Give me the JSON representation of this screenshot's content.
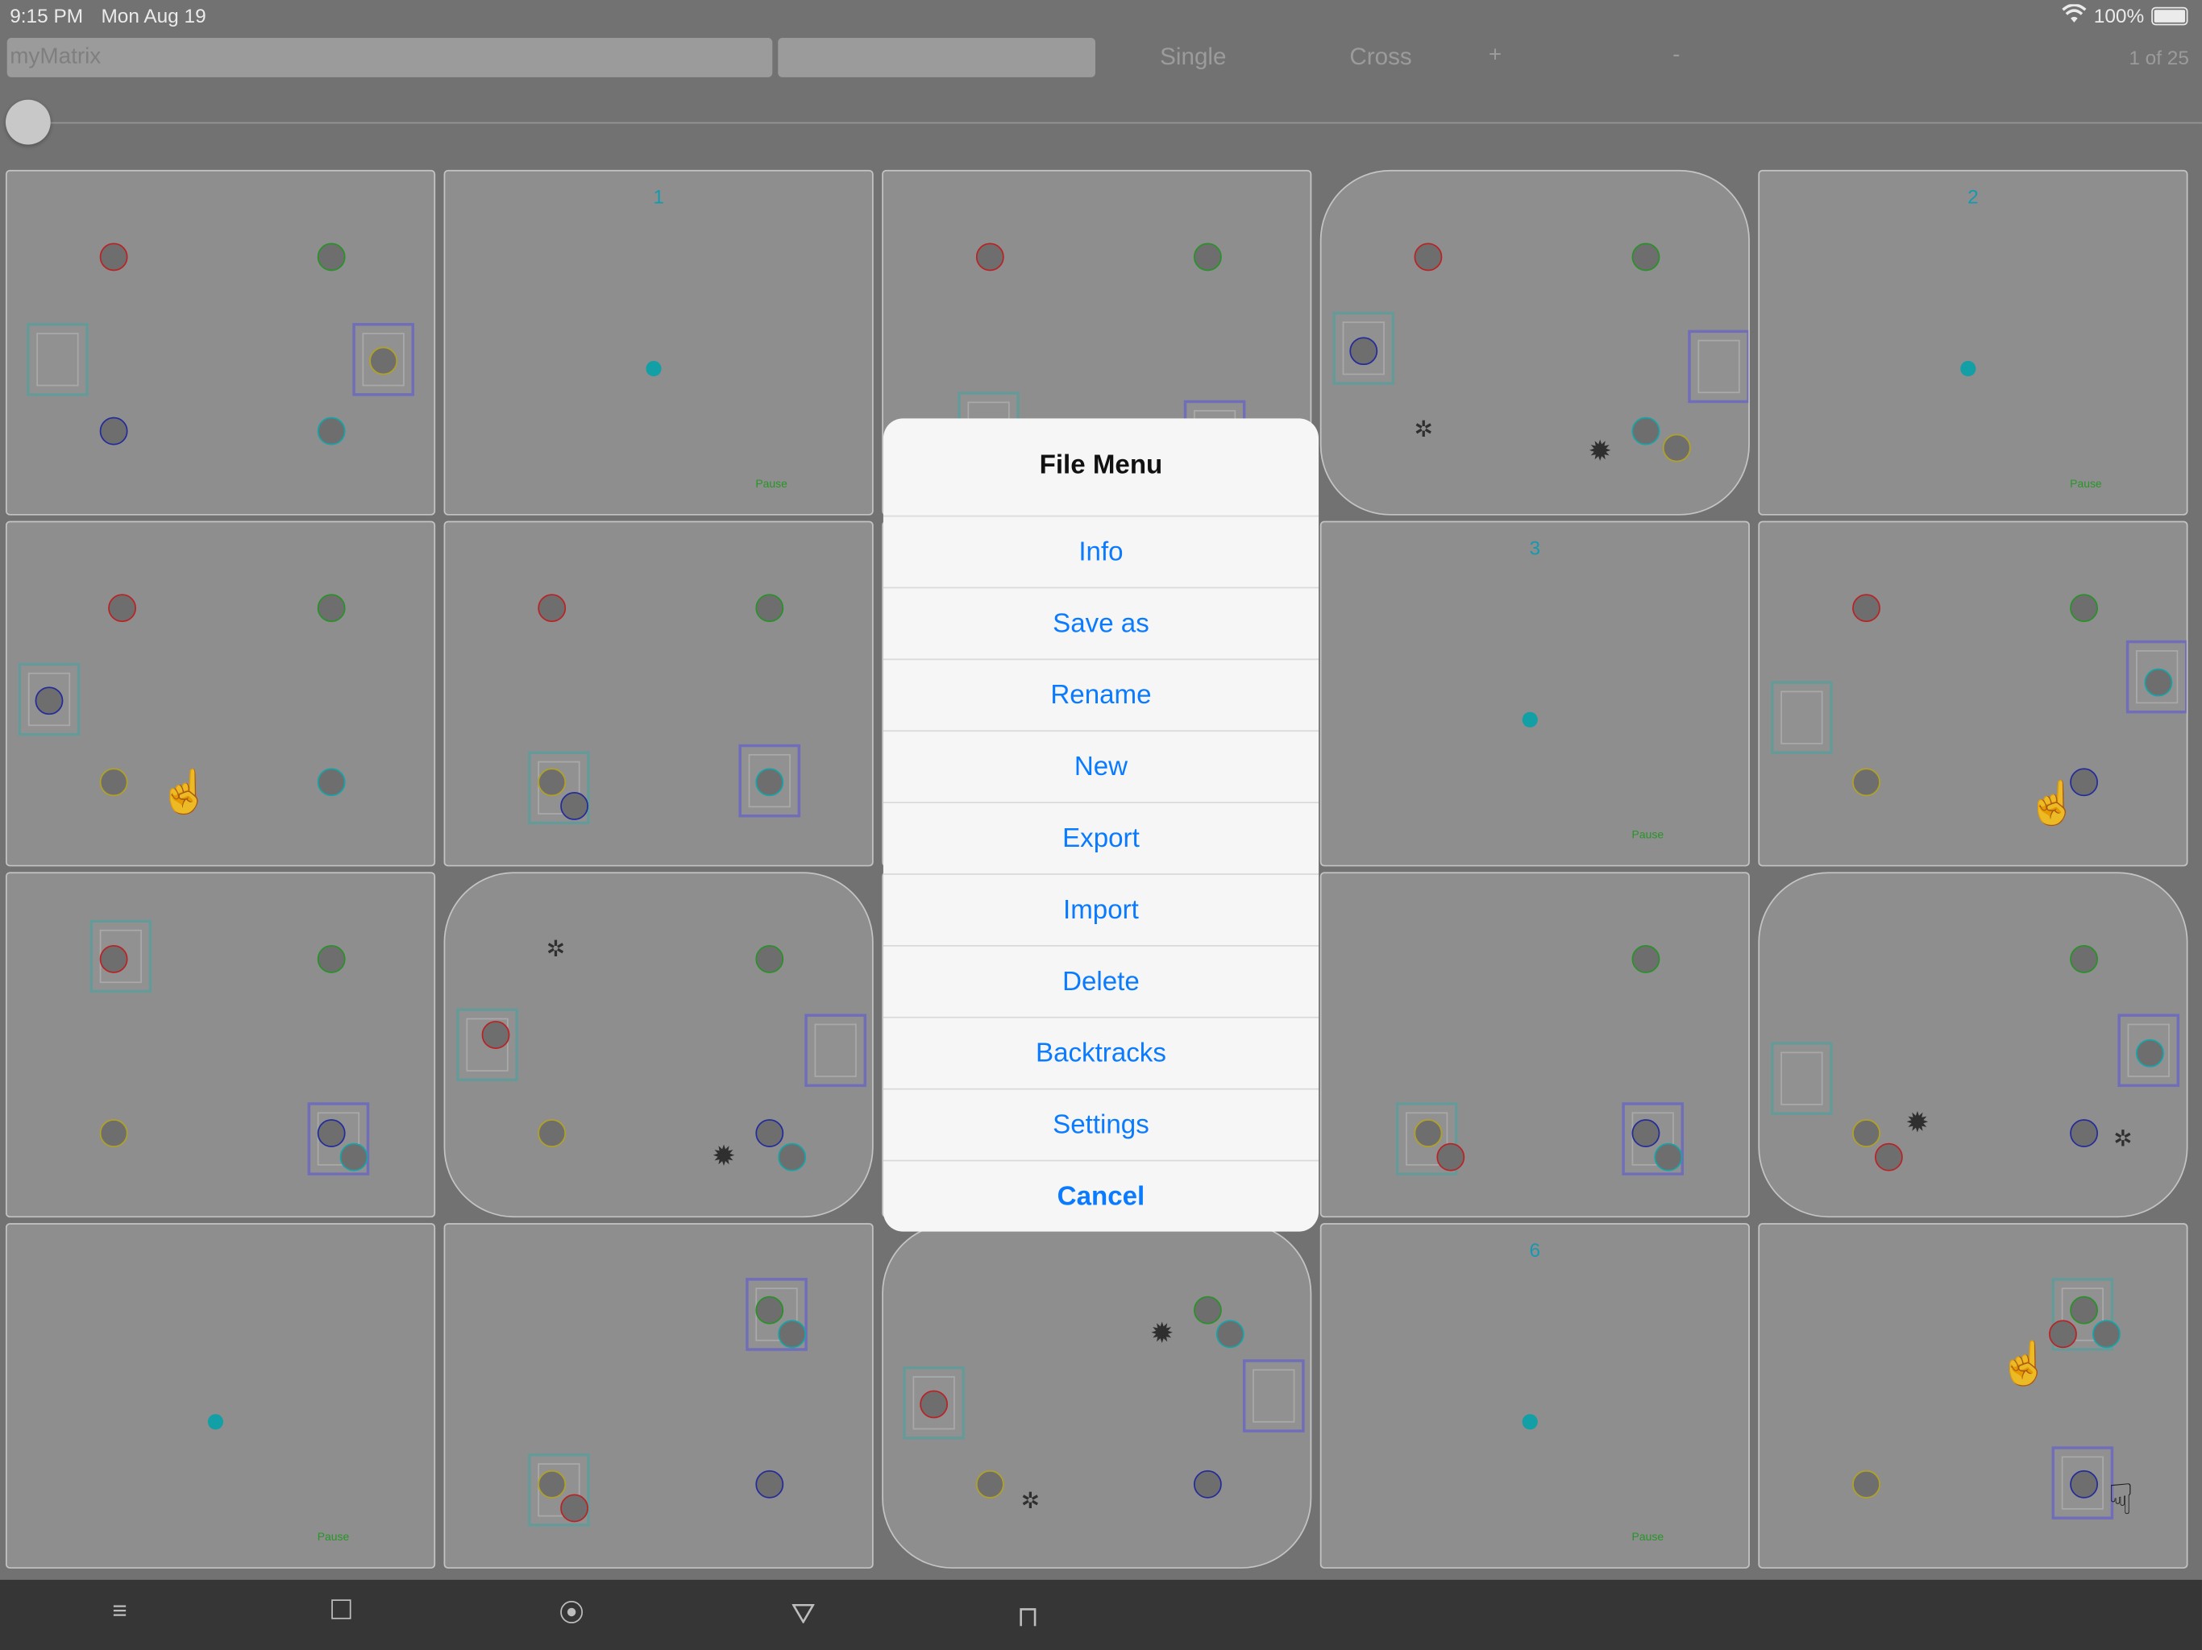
{
  "status": {
    "time": "9:15 PM",
    "date": "Mon Aug 19",
    "battery": "100%"
  },
  "toolbar": {
    "name_value": "myMatrix",
    "second_value": "",
    "single_label": "Single",
    "cross_label": "Cross",
    "plus_label": "+",
    "minus_label": "-",
    "page_counter": "1 of 25"
  },
  "cells": {
    "c2_number": "1",
    "c2_pause": "Pause",
    "c5_number": "2",
    "c5_pause": "Pause",
    "c8_number": "3",
    "c8_pause": "Pause",
    "c16_pause": "Pause",
    "c19_number": "6",
    "c19_pause": "Pause"
  },
  "file_menu": {
    "title": "File Menu",
    "items": [
      "Info",
      "Save as",
      "Rename",
      "New",
      "Export",
      "Import",
      "Delete",
      "Backtracks",
      "Settings"
    ],
    "cancel": "Cancel"
  },
  "bottom_toolbar": {
    "icons": [
      "hamburger-icon",
      "square-icon",
      "target-icon",
      "triangle-icon",
      "bracket-icon"
    ]
  },
  "colors": {
    "accent": "#0a7aff",
    "cyan": "#14adb3",
    "pause_green": "#2aa32a"
  }
}
